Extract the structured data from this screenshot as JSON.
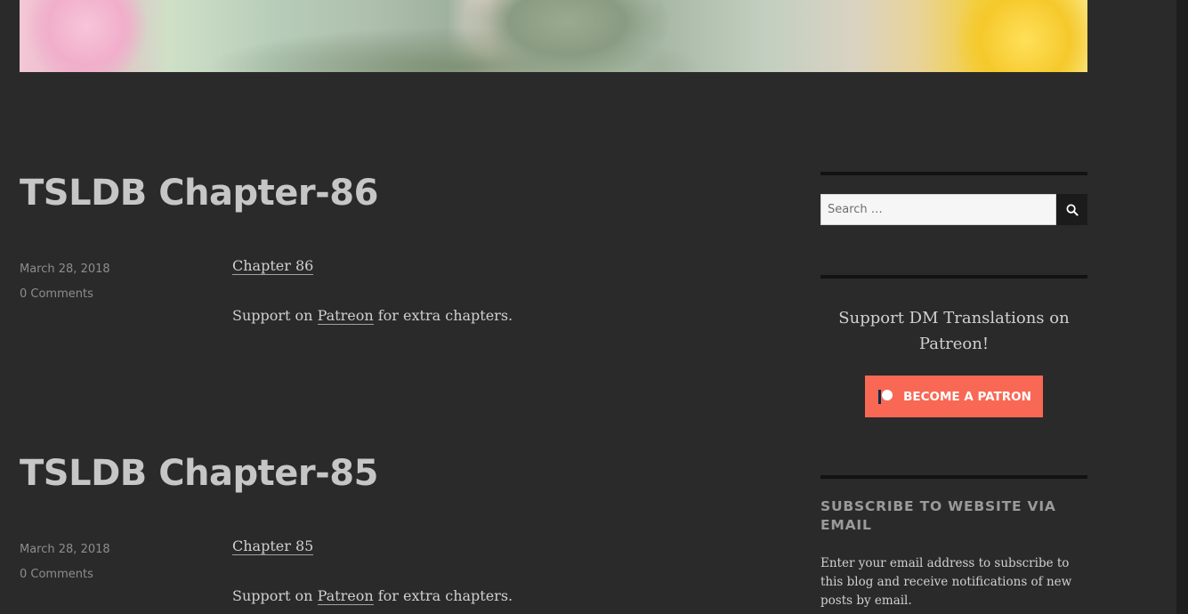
{
  "posts": [
    {
      "title": "TSLDB Chapter-86",
      "date": "March 28, 2018",
      "comments": "0 Comments",
      "chapter_link": "Chapter 86",
      "support_prefix": "Support on ",
      "support_link": "Patreon",
      "support_suffix": " for extra chapters."
    },
    {
      "title": "TSLDB Chapter-85",
      "date": "March 28, 2018",
      "comments": "0 Comments",
      "chapter_link": "Chapter 85",
      "support_prefix": "Support on ",
      "support_link": "Patreon",
      "support_suffix": " for extra chapters."
    }
  ],
  "sidebar": {
    "search": {
      "placeholder": "Search …",
      "button_icon": "search-icon"
    },
    "patreon": {
      "text": "Support DM Translations on Patreon!",
      "button_label": "BECOME A PATRON",
      "button_icon": "patreon-logo-icon",
      "button_color": "#f96854"
    },
    "subscribe": {
      "title": "SUBSCRIBE TO WEBSITE VIA EMAIL",
      "text": "Enter your email address to subscribe to this blog and receive notifications of new posts by email."
    }
  },
  "colors": {
    "background": "#2a2a2a",
    "title": "#c6c6c6",
    "meta": "#8d8d8d"
  }
}
